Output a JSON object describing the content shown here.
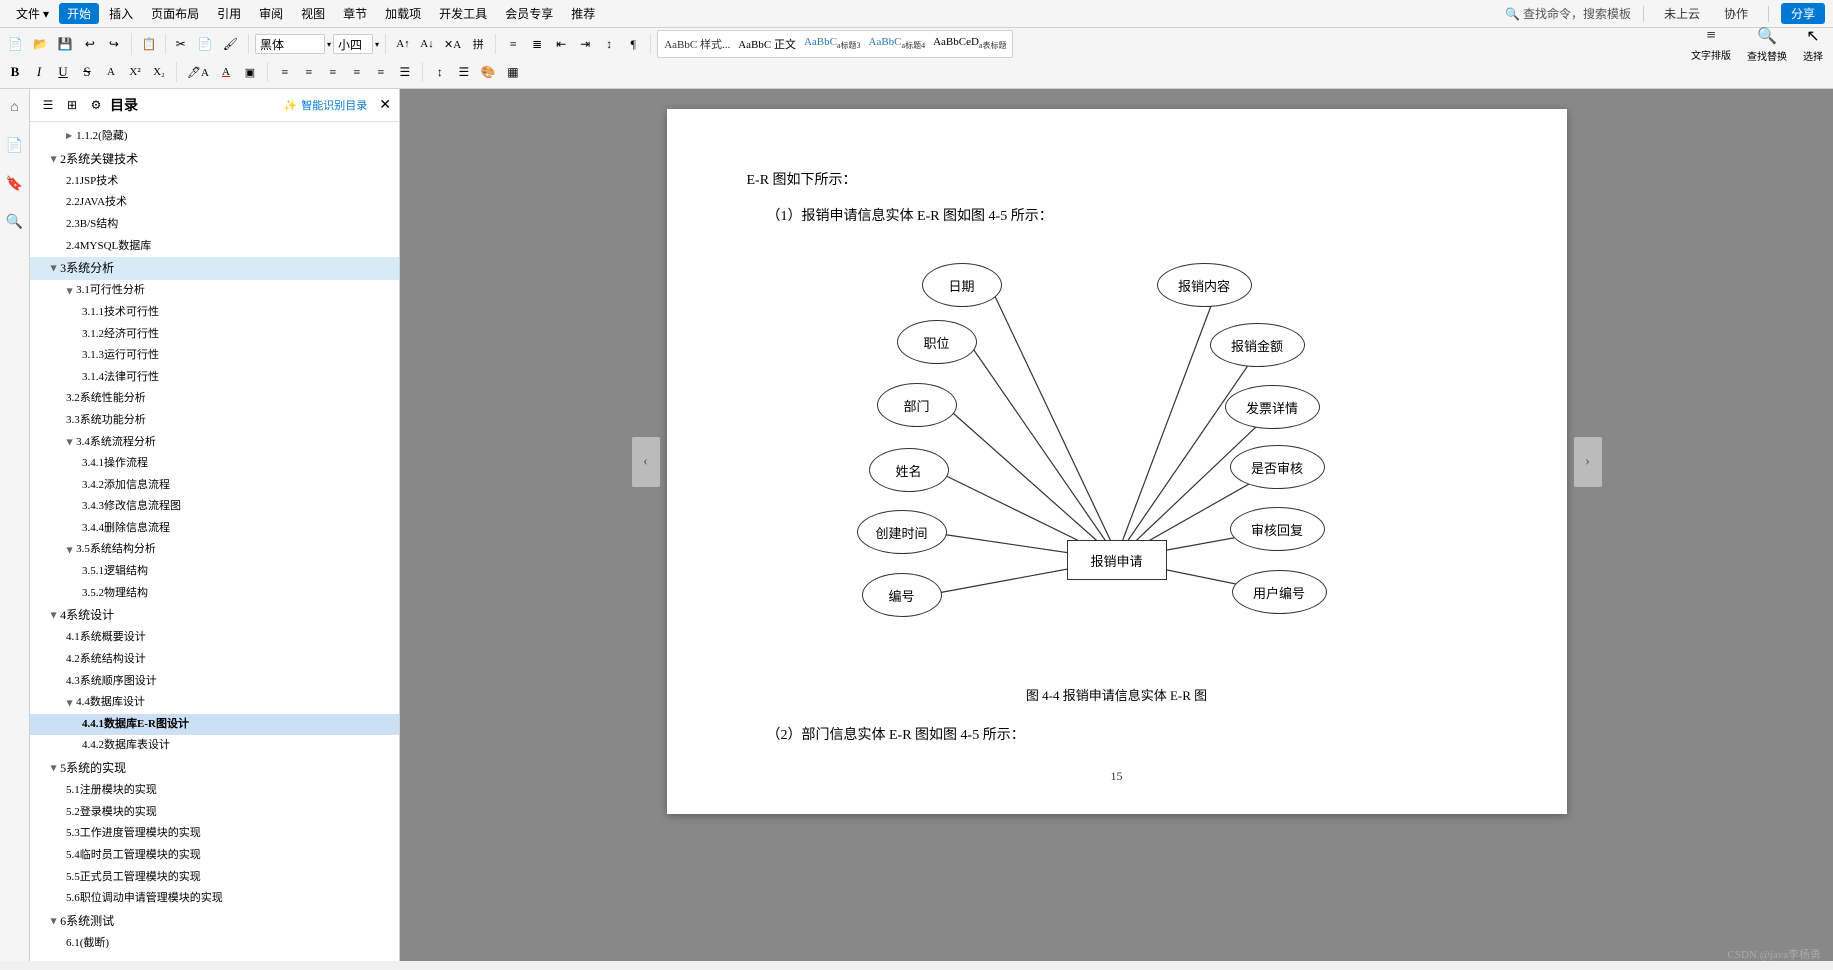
{
  "app": {
    "title": "WPS文字"
  },
  "menu": {
    "items": [
      "文件",
      "开始",
      "插入",
      "页面布局",
      "引用",
      "审阅",
      "视图",
      "章节",
      "加载项",
      "开发工具",
      "会员专享",
      "推荐"
    ],
    "active_item": "开始",
    "search_placeholder": "查找命令，搜索模板",
    "right_items": [
      "未上云",
      "协作"
    ],
    "save_btn": "分享"
  },
  "toolbar": {
    "clipboard": {
      "paste_label": "粘贴",
      "cut_label": "剪切",
      "copy_label": "复制",
      "format_label": "格式刷"
    },
    "font": {
      "name": "黑体",
      "size": "小四",
      "bold": "B",
      "italic": "I",
      "underline": "U",
      "strikethrough": "S"
    },
    "paragraph": {
      "bullets": "≡",
      "numbering": "≡"
    },
    "styles": [
      "AaBbC 样式...",
      "AaBbC 正文",
      "AaBbC a标题3",
      "AaBbC a标题4",
      "AaBbCeD a表标题"
    ],
    "text_layout": "文字排版",
    "find_replace": "查找替换",
    "select": "选择"
  },
  "sidebar": {
    "title": "目录",
    "ai_btn": "智能识别目录",
    "items": [
      {
        "level": 3,
        "text": "1.1.2(隐藏)",
        "expanded": false
      },
      {
        "level": 2,
        "text": "2系统关键技术",
        "expanded": true
      },
      {
        "level": 3,
        "text": "2.1JSP技术"
      },
      {
        "level": 3,
        "text": "2.2JAVA技术"
      },
      {
        "level": 3,
        "text": "2.3B/S结构"
      },
      {
        "level": 3,
        "text": "2.4MYSQL数据库"
      },
      {
        "level": 2,
        "text": "3系统分析",
        "expanded": true,
        "active": false
      },
      {
        "level": 3,
        "text": "3.1可行性分析",
        "expanded": true
      },
      {
        "level": 4,
        "text": "3.1.1技术可行性"
      },
      {
        "level": 4,
        "text": "3.1.2经济可行性"
      },
      {
        "level": 4,
        "text": "3.1.3运行可行性"
      },
      {
        "level": 4,
        "text": "3.1.4法律可行性"
      },
      {
        "level": 3,
        "text": "3.2系统性能分析"
      },
      {
        "level": 3,
        "text": "3.3系统功能分析"
      },
      {
        "level": 3,
        "text": "3.4系统流程分析",
        "expanded": true
      },
      {
        "level": 4,
        "text": "3.4.1操作流程"
      },
      {
        "level": 4,
        "text": "3.4.2添加信息流程"
      },
      {
        "level": 4,
        "text": "3.4.3修改信息流程图"
      },
      {
        "level": 4,
        "text": "3.4.4删除信息流程"
      },
      {
        "level": 3,
        "text": "3.5系统结构分析",
        "expanded": true
      },
      {
        "level": 4,
        "text": "3.5.1逻辑结构"
      },
      {
        "level": 4,
        "text": "3.5.2物理结构"
      },
      {
        "level": 2,
        "text": "4系统设计",
        "expanded": true
      },
      {
        "level": 3,
        "text": "4.1系统概要设计"
      },
      {
        "level": 3,
        "text": "4.2系统结构设计"
      },
      {
        "level": 3,
        "text": "4.3系统顺序图设计"
      },
      {
        "level": 3,
        "text": "4.4数据库设计",
        "expanded": true
      },
      {
        "level": 4,
        "text": "4.4.1数据库E-R图设计",
        "active": true
      },
      {
        "level": 4,
        "text": "4.4.2数据库表设计"
      },
      {
        "level": 2,
        "text": "5系统的实现",
        "expanded": true
      },
      {
        "level": 3,
        "text": "5.1注册模块的实现"
      },
      {
        "level": 3,
        "text": "5.2登录模块的实现"
      },
      {
        "level": 3,
        "text": "5.3工作进度管理模块的实现"
      },
      {
        "level": 3,
        "text": "5.4临时员工管理模块的实现"
      },
      {
        "level": 3,
        "text": "5.5正式员工管理模块的实现"
      },
      {
        "level": 3,
        "text": "5.6职位调动申请管理模块的实现"
      },
      {
        "level": 2,
        "text": "6系统测试",
        "expanded": true
      },
      {
        "level": 3,
        "text": "6.1(截断)"
      }
    ]
  },
  "document": {
    "intro_text": "E-R 图如下所示：",
    "section1_title": "（1）报销申请信息实体 E-R 图如图 4-5 所示：",
    "er_diagram": {
      "center_node": "报销申请",
      "ellipse_nodes": [
        "日期",
        "报销内容",
        "职位",
        "报销金额",
        "部门",
        "发票详情",
        "姓名",
        "是否审核",
        "创建时间",
        "审核回复",
        "编号",
        "用户编号"
      ]
    },
    "fig_caption": "图 4-4    报销申请信息实体 E-R 图",
    "section2_title": "（2）部门信息实体 E-R 图如图 4-5 所示：",
    "page_number": "15"
  },
  "watermark": "CSDN @java李杨勇"
}
